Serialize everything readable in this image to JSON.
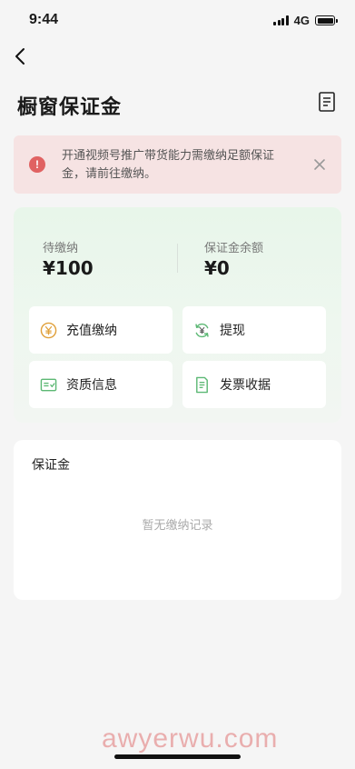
{
  "status_bar": {
    "time": "9:44",
    "network": "4G"
  },
  "header": {
    "title": "橱窗保证金"
  },
  "alert": {
    "message": "开通视频号推广带货能力需缴纳足额保证金，请前往缴纳。"
  },
  "balances": [
    {
      "label": "待缴纳",
      "value": "¥100"
    },
    {
      "label": "保证金余额",
      "value": "¥0"
    }
  ],
  "actions": [
    {
      "label": "充值缴纳",
      "icon": "yuan-coin-icon"
    },
    {
      "label": "提现",
      "icon": "yuan-refresh-icon"
    },
    {
      "label": "资质信息",
      "icon": "id-card-icon"
    },
    {
      "label": "发票收据",
      "icon": "receipt-icon"
    }
  ],
  "records": {
    "title": "保证金",
    "empty_text": "暂无缴纳记录"
  },
  "watermark": "awyerwu.com",
  "colors": {
    "accent_green": "#5cb874",
    "alert_red": "#e06262",
    "coin_orange": "#e0a03a"
  }
}
